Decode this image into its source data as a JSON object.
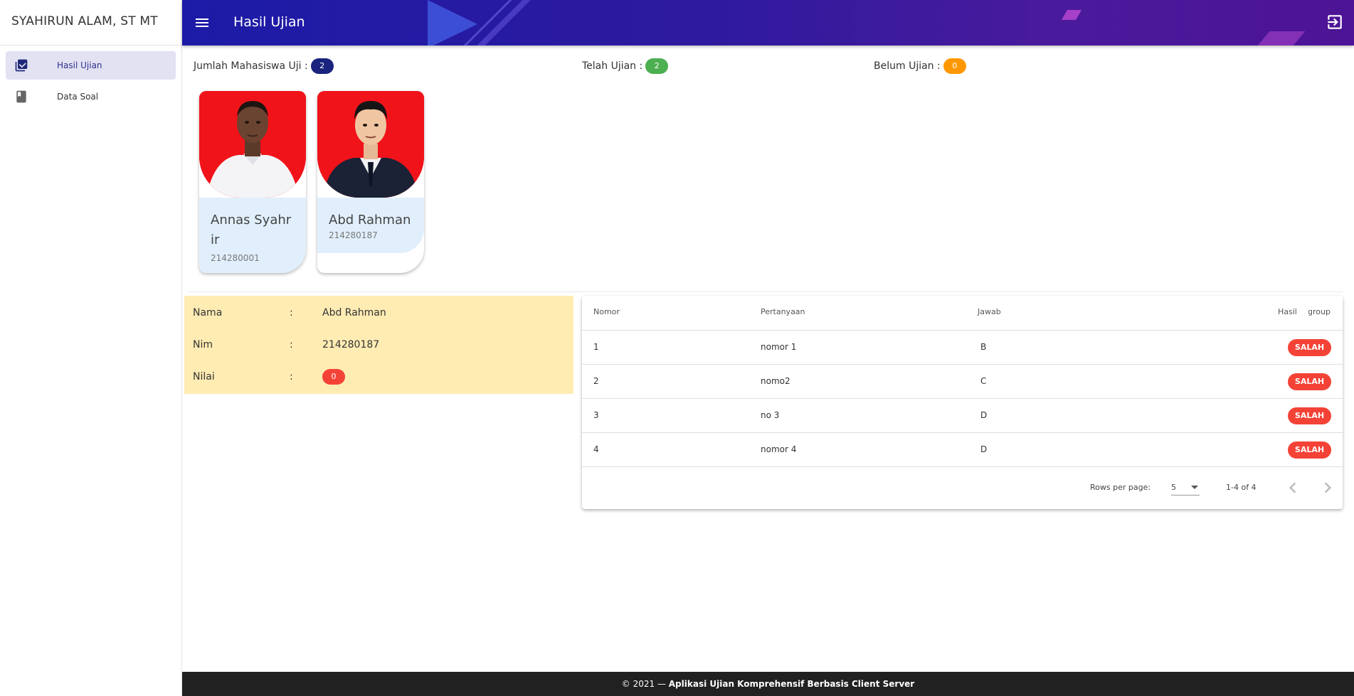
{
  "sidebar": {
    "user_name": "SYAHIRUN ALAM, ST MT",
    "items": [
      {
        "label": "Hasil Ujian",
        "icon": "checklist-icon",
        "active": true
      },
      {
        "label": "Data Soal",
        "icon": "book-icon",
        "active": false
      }
    ]
  },
  "header": {
    "title": "Hasil Ujian",
    "menu_icon": "menu-icon",
    "logout_icon": "logout-icon",
    "accent": "#1c1ba7"
  },
  "stats": {
    "total_label": "Jumlah Mahasiswa Uji :",
    "total_value": "2",
    "done_label": "Telah Ujian :",
    "done_value": "2",
    "pending_label": "Belum Ujian :",
    "pending_value": "0",
    "colors": {
      "total": "#1a237e",
      "done": "#4caf50",
      "pending": "#ff9800"
    }
  },
  "students": [
    {
      "name": "Annas Syahrir",
      "nim": "214280001"
    },
    {
      "name": "Abd Rahman",
      "nim": "214280187"
    }
  ],
  "detail": {
    "name_label": "Nama",
    "name_value": "Abd Rahman",
    "nim_label": "Nim",
    "nim_value": "214280187",
    "score_label": "Nilai",
    "score_value": "0",
    "separator": ":"
  },
  "table": {
    "headers": {
      "nomor": "Nomor",
      "pertanyaan": "Pertanyaan",
      "jawab": "Jawab",
      "hasil": "Hasil",
      "group": "group"
    },
    "rows": [
      {
        "nomor": "1",
        "pertanyaan": "nomor 1",
        "jawab": "B",
        "hasil": "SALAH"
      },
      {
        "nomor": "2",
        "pertanyaan": "nomo2",
        "jawab": "C",
        "hasil": "SALAH"
      },
      {
        "nomor": "3",
        "pertanyaan": "no 3",
        "jawab": "D",
        "hasil": "SALAH"
      },
      {
        "nomor": "4",
        "pertanyaan": "nomor 4",
        "jawab": "D",
        "hasil": "SALAH"
      }
    ],
    "footer": {
      "rows_per_page_label": "Rows per page:",
      "rows_per_page_value": "5",
      "range": "1-4 of 4"
    }
  },
  "footer": {
    "prefix": "© 2021 — ",
    "app_name": "Aplikasi Ujian Komprehensif Berbasis Client Server"
  }
}
